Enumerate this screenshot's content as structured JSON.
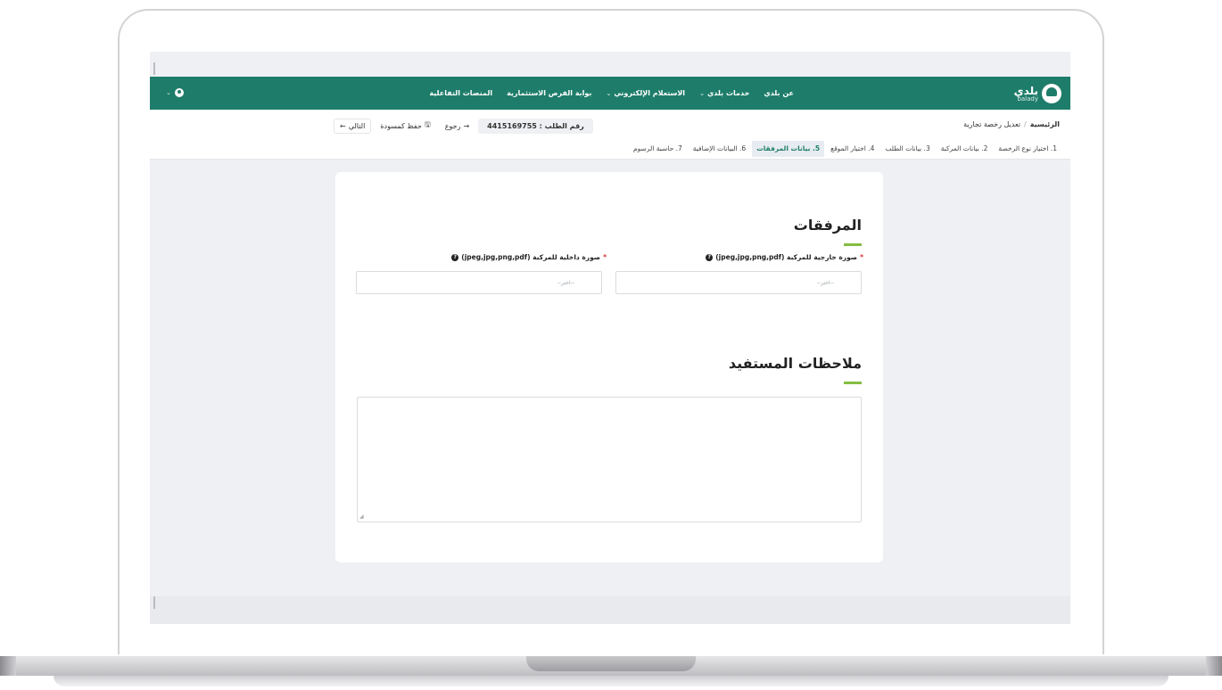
{
  "nav": {
    "logo_ar": "بلدي",
    "logo_en": "balady",
    "links": [
      {
        "label": "عن بلدي",
        "has_dropdown": false
      },
      {
        "label": "خدمات بلدي",
        "has_dropdown": true
      },
      {
        "label": "الاستعلام الإلكتروني",
        "has_dropdown": true
      },
      {
        "label": "بوابة الفرص الاستثمارية",
        "has_dropdown": false
      },
      {
        "label": "المنصات التفاعلية",
        "has_dropdown": false
      }
    ],
    "user_icon": "user-icon",
    "dropdown_glyph": "⌄"
  },
  "breadcrumb": {
    "home": "الرئيسية",
    "separator": "/",
    "current": "تعديل رخصة تجارية"
  },
  "actions": {
    "request_number": "رقم الطلب : 4415169755",
    "back_label": "رجوع",
    "back_arrow": "→",
    "save_draft_label": "حفظ كمسودة",
    "save_icon": "🖫",
    "next_label": "التالي",
    "next_arrow": "←"
  },
  "steps": [
    {
      "label": "1. اختيار نوع الرخصة",
      "active": false
    },
    {
      "label": "2. بيانات المركبة",
      "active": false
    },
    {
      "label": "3. بيانات الطلب",
      "active": false
    },
    {
      "label": "4. اختيار الموقع",
      "active": false
    },
    {
      "label": "5. بيانات المرفقات",
      "active": true
    },
    {
      "label": "6. البيانات الإضافية",
      "active": false
    },
    {
      "label": "7. حاسبة الرسوم",
      "active": false
    }
  ],
  "attachments": {
    "title": "المرفقات",
    "required_mark": "*",
    "help_glyph": "?",
    "exterior": {
      "label": "صورة خارجية للمركبة (jpeg,jpg,png,pdf)",
      "placeholder": "--اختر--"
    },
    "interior": {
      "label": "صورة داخلية للمركبة (jpeg,jpg,png,pdf)",
      "placeholder": "--اختر--"
    }
  },
  "notes": {
    "title": "ملاحظات المستفيد",
    "value": ""
  },
  "colors": {
    "brand_green": "#1e7d6a",
    "accent_green": "#84bd41",
    "required_red": "#dd3333"
  }
}
